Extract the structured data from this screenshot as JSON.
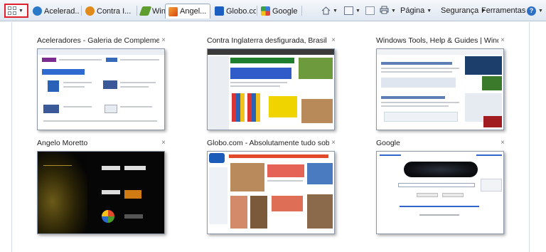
{
  "toolbar": {
    "tabs": [
      {
        "label": "Acelerad...",
        "icon": "ie-icon",
        "color": "#2a78c8",
        "active": false
      },
      {
        "label": "Contra I...",
        "icon": "gear-icon",
        "color": "#e08a1a",
        "active": false
      },
      {
        "label": "Window...",
        "icon": "leaf-icon",
        "color": "#5e9e2f",
        "active": false
      },
      {
        "label": "Angel...",
        "icon": "envelope-icon",
        "color": "#e36a12",
        "active": true,
        "close": "×"
      },
      {
        "label": "Globo.co...",
        "icon": "globo-icon",
        "color": "#1d5fc1",
        "active": false
      },
      {
        "label": "Google",
        "icon": "google-icon",
        "color": "#3a7de0",
        "active": false
      }
    ],
    "commands": {
      "page": "Página",
      "security": "Segurança",
      "tools": "Ferramentas"
    }
  },
  "quick_tabs": [
    {
      "title": "Aceleradores - Galeria de Complementos",
      "close": "×"
    },
    {
      "title": "Contra Inglaterra desfigurada, Brasil def...",
      "close": "×"
    },
    {
      "title": "Windows Tools, Help & Guides | Windo...",
      "close": "×"
    },
    {
      "title": "Angelo Moretto",
      "close": "×"
    },
    {
      "title": "Globo.com - Absolutamente tudo sobr...",
      "close": "×"
    },
    {
      "title": "Google",
      "close": "×"
    }
  ]
}
